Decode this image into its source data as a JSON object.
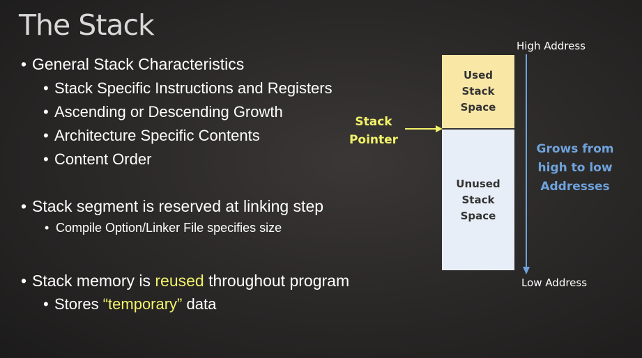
{
  "title": "The Stack",
  "bullets": {
    "b1": "General Stack Characteristics",
    "b1_1": "Stack Specific Instructions and Registers",
    "b1_2": "Ascending or Descending Growth",
    "b1_3": "Architecture Specific Contents",
    "b1_4": "Content Order",
    "b2": "Stack segment is reserved at linking step",
    "b2_1": "Compile Option/Linker File specifies size",
    "b3_pre": "Stack memory is ",
    "b3_hl": "reused",
    "b3_post": " throughout program",
    "b3_1_pre": "Stores ",
    "b3_1_hl": "“temporary”",
    "b3_1_post": " data"
  },
  "diagram": {
    "high_address": "High Address",
    "low_address": "Low Address",
    "used_space": [
      "Used",
      "Stack",
      "Space"
    ],
    "unused_space": [
      "Unused",
      "Stack",
      "Space"
    ],
    "stack_pointer": [
      "Stack",
      "Pointer"
    ],
    "grows": [
      "Grows from",
      "high to low",
      "Addresses"
    ]
  },
  "colors": {
    "highlight": "#f2f26a",
    "used_fill": "#f9e7a6",
    "unused_fill": "#e8eef7",
    "grows_text": "#6fa3dc",
    "arrow": "#6fa3dc"
  },
  "icons": {
    "bullet": "bullet-dot",
    "stack_pointer_arrow": "right-arrow",
    "growth_arrow": "down-arrow"
  }
}
